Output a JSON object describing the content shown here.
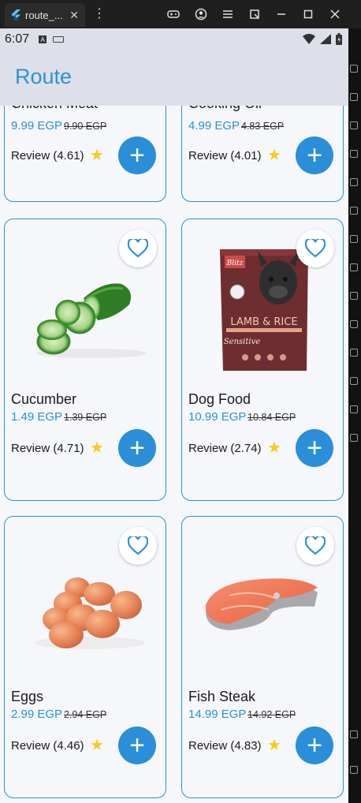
{
  "window": {
    "tab_title": "route_...",
    "tab_close": "✕",
    "menu_dots": "⋮"
  },
  "status_bar": {
    "time": "6:07",
    "a_icon": "A"
  },
  "app_bar": {
    "title": "Route"
  },
  "products": [
    {
      "name": "Chicken Meat",
      "price": "9.99 EGP",
      "old_price": "9.90 EGP",
      "review": "Review (4.61)"
    },
    {
      "name": "Cooking Oil",
      "price": "4.99 EGP",
      "old_price": "4.83 EGP",
      "review": "Review (4.01)"
    },
    {
      "name": "Cucumber",
      "price": "1.49 EGP",
      "old_price": "1.39 EGP",
      "review": "Review (4.71)"
    },
    {
      "name": "Dog Food",
      "price": "10.99 EGP",
      "old_price": "10.84 EGP",
      "review": "Review (2.74)"
    },
    {
      "name": "Eggs",
      "price": "2.99 EGP",
      "old_price": "2.94 EGP",
      "review": "Review (4.46)"
    },
    {
      "name": "Fish Steak",
      "price": "14.99 EGP",
      "old_price": "14.92 EGP",
      "review": "Review (4.83)"
    }
  ],
  "dog_food_pack": {
    "brand": "Blitz",
    "line1": "LAMB & RICE",
    "line2": "Sensitive"
  },
  "icons": {
    "star": "★",
    "add": "+"
  },
  "colors": {
    "accent": "#2a8fd8",
    "star": "#f6cc1d",
    "appbar": "#dde0e9"
  }
}
